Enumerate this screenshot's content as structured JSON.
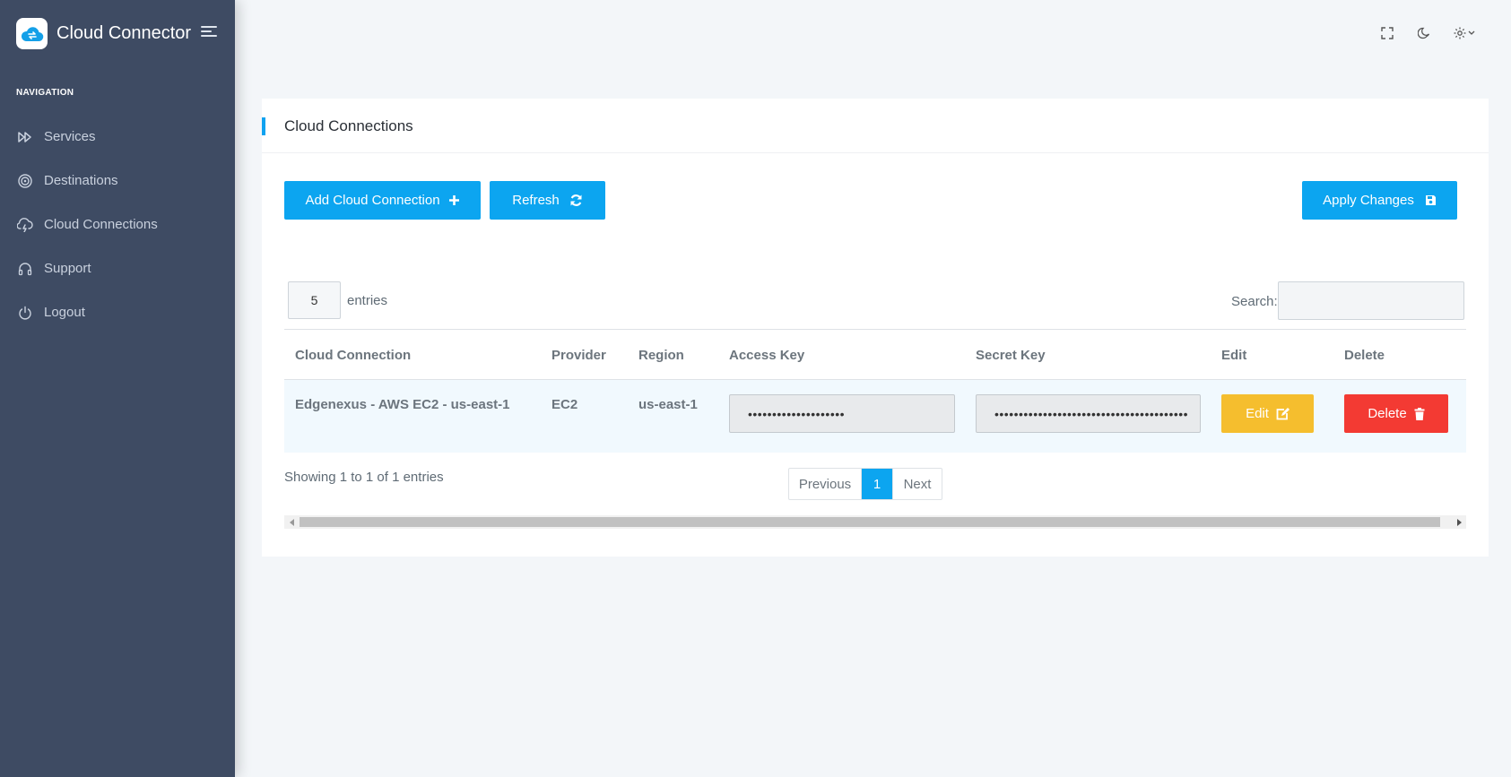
{
  "app": {
    "title": "Cloud Connector"
  },
  "sidebar": {
    "heading": "NAVIGATION",
    "items": [
      {
        "label": "Services",
        "icon": "fast-forward-icon"
      },
      {
        "label": "Destinations",
        "icon": "target-icon"
      },
      {
        "label": "Cloud Connections",
        "icon": "cloud-lightning-icon"
      },
      {
        "label": "Support",
        "icon": "headphones-icon"
      },
      {
        "label": "Logout",
        "icon": "power-icon"
      }
    ]
  },
  "topbar": {
    "icons": [
      "fullscreen-icon",
      "moon-icon",
      "gear-icon",
      "chevron-down-icon"
    ]
  },
  "card": {
    "title": "Cloud Connections",
    "buttons": {
      "add": "Add Cloud Connection",
      "refresh": "Refresh",
      "apply": "Apply Changes"
    }
  },
  "table": {
    "length_value": "5",
    "length_label": "entries",
    "search_label": "Search:",
    "search_value": "",
    "headers": [
      "Cloud Connection",
      "Provider",
      "Region",
      "Access Key",
      "Secret Key",
      "Edit",
      "Delete"
    ],
    "rows": [
      {
        "connection": "Edgenexus - AWS EC2 - us-east-1",
        "provider": "EC2",
        "region": "us-east-1",
        "access_key": "••••••••••••••••••••",
        "secret_key": "••••••••••••••••••••••••••••••••••••••••",
        "edit_label": "Edit",
        "delete_label": "Delete"
      }
    ],
    "info": "Showing 1 to 1 of 1 entries",
    "pagination": {
      "previous": "Previous",
      "current": "1",
      "next": "Next"
    }
  },
  "colors": {
    "sidebar": "#3e4b63",
    "primary": "#0ca5f0",
    "warning": "#f5be2e",
    "danger": "#f33a33"
  }
}
